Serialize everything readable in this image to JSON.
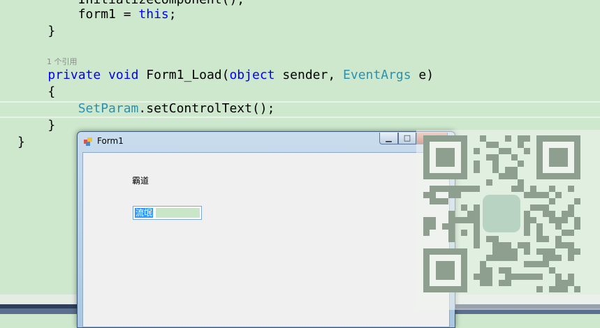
{
  "editor": {
    "lines": [
      {
        "indent": "        ",
        "parts": [
          {
            "t": "InitializeComponent();",
            "c": ""
          }
        ]
      },
      {
        "indent": "        ",
        "parts": [
          {
            "t": "form1 = ",
            "c": ""
          },
          {
            "t": "this",
            "c": "kw"
          },
          {
            "t": ";",
            "c": ""
          }
        ]
      },
      {
        "indent": "    ",
        "parts": [
          {
            "t": "}",
            "c": ""
          }
        ]
      },
      {
        "indent": "    ",
        "parts": [
          {
            "t": "private",
            "c": "kw"
          },
          {
            "t": " ",
            "c": ""
          },
          {
            "t": "void",
            "c": "kw"
          },
          {
            "t": " Form1_Load(",
            "c": ""
          },
          {
            "t": "object",
            "c": "kw"
          },
          {
            "t": " sender, ",
            "c": ""
          },
          {
            "t": "EventArgs",
            "c": "ty"
          },
          {
            "t": " e)",
            "c": ""
          }
        ]
      },
      {
        "indent": "    ",
        "parts": [
          {
            "t": "{",
            "c": ""
          }
        ]
      },
      {
        "indent": "        ",
        "parts": [
          {
            "t": "SetParam",
            "c": "ty"
          },
          {
            "t": ".setControlText();",
            "c": ""
          }
        ]
      },
      {
        "indent": "    ",
        "parts": [
          {
            "t": "}",
            "c": ""
          }
        ]
      },
      {
        "indent": "",
        "parts": [
          {
            "t": "}",
            "c": ""
          }
        ]
      }
    ],
    "ref_count": "1 个引用"
  },
  "window": {
    "title": "Form1",
    "minimize_symbol": "▁",
    "maximize_symbol": "□",
    "close_symbol": "✕",
    "label_text": "霸道",
    "textbox_selected": "流氓"
  },
  "qr_code": {
    "icon": "qr-code-icon"
  },
  "colors": {
    "editor_bg": "#cde8cd",
    "keyword": "#0000ff",
    "type": "#2b91af"
  }
}
